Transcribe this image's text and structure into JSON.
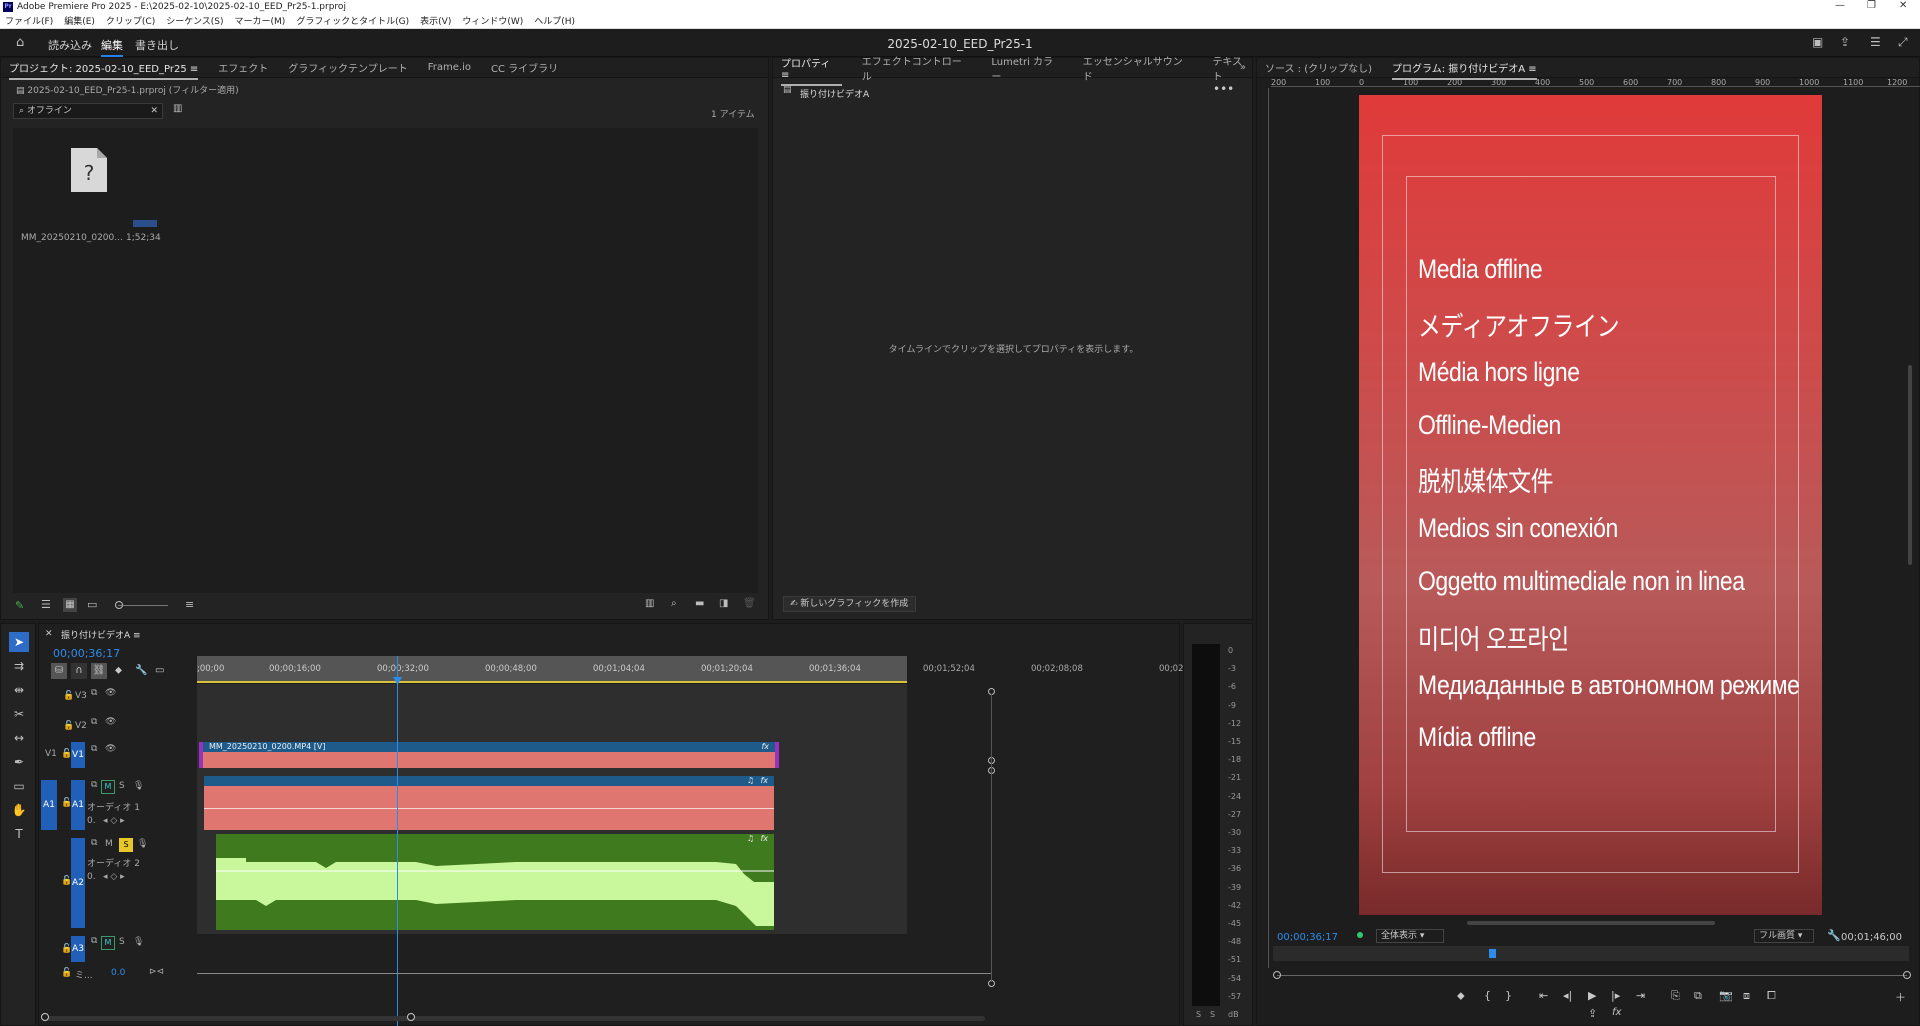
{
  "window": {
    "title": "Adobe Premiere Pro 2025 - E:\\2025-02-10\\2025-02-10_EED_Pr25-1.prproj",
    "app_icon": "Pr"
  },
  "menu": [
    "ファイル(F)",
    "編集(E)",
    "クリップ(C)",
    "シーケンス(S)",
    "マーカー(M)",
    "グラフィックとタイトル(G)",
    "表示(V)",
    "ウィンドウ(W)",
    "ヘルプ(H)"
  ],
  "header": {
    "nav": [
      "読み込み",
      "編集",
      "書き出し"
    ],
    "active": "編集",
    "sequence_title": "2025-02-10_EED_Pr25-1"
  },
  "project_panel": {
    "tabs": [
      "プロジェクト: 2025-02-10_EED_Pr25 ≡",
      "エフェクト",
      "グラフィックテンプレート",
      "Frame.io",
      "CC ライブラリ"
    ],
    "file": "2025-02-10_EED_Pr25-1.prproj (フィルター適用)",
    "search_value": "オフライン",
    "item_count": "1 アイテム",
    "item": {
      "name": "MM_20250210_0200...",
      "duration": "1;52;34"
    }
  },
  "properties_panel": {
    "tabs": [
      "プロパティ ≡",
      "エフェクトコントロール",
      "Lumetri カラー",
      "エッセンシャルサウンド",
      "テキスト"
    ],
    "clip_name": "振り付けビデオA",
    "message": "タイムラインでクリップを選択してプロパティを表示します。",
    "new_graphic_button": "新しいグラフィックを作成"
  },
  "program_monitor": {
    "tabs": [
      "ソース : (クリップなし)",
      "プログラム: 振り付けビデオA ≡"
    ],
    "ruler": [
      "200",
      "100",
      "0",
      "100",
      "200",
      "300",
      "400",
      "500",
      "600",
      "700",
      "800",
      "900",
      "1000",
      "1100",
      "1200"
    ],
    "offline_lines": [
      "Media offline",
      "メディアオフライン",
      "Média hors ligne",
      "Offline-Medien",
      "脱机媒体文件",
      "Medios sin conexión",
      "Oggetto multimediale non in linea",
      "미디어 오프라인",
      "Медиаданные в автономном режиме",
      "Mídia offline"
    ],
    "timecode": "00;00;36;17",
    "zoom": "全体表示",
    "quality": "フル画質",
    "duration": "00;01;46;00"
  },
  "timeline": {
    "tab": "振り付けビデオA ≡",
    "timecode": "00;00;36;17",
    "ruler": [
      ";00;00",
      "00;00;16;00",
      "00;00;32;00",
      "00;00;48;00",
      "00;01;04;04",
      "00;01;20;04",
      "00;01;36;04",
      "00;01;52;04",
      "00;02;08;08",
      "00;02"
    ],
    "tracks": {
      "v3": "V3",
      "v2": "V2",
      "v1": "V1",
      "v1_src": "V1",
      "a1": "A1",
      "a1_src": "A1",
      "a1_name": "オーディオ 1",
      "a2": "A2",
      "a2_name": "オーディオ 2",
      "a3": "A3",
      "mix": "ミ...",
      "mix_value": "0.0",
      "vol": "0."
    },
    "video_clip": "MM_20250210_0200.MP4 [V]",
    "m_label": "M",
    "s_label": "S"
  },
  "vu_meter": {
    "scale": [
      "0",
      "-3",
      "-6",
      "-9",
      "-12",
      "-15",
      "-18",
      "-21",
      "-24",
      "-27",
      "-30",
      "-33",
      "-36",
      "-39",
      "-42",
      "-45",
      "-48",
      "-51",
      "-54",
      "-57",
      "dB"
    ],
    "bottom": [
      "S",
      "S"
    ]
  },
  "colors": {
    "accent": "#2680eb",
    "clip_video": "#e07670",
    "clip_audio_bg": "#3f7a1f",
    "waveform": "#c9f79b",
    "offline_red": "#d63a3a"
  }
}
